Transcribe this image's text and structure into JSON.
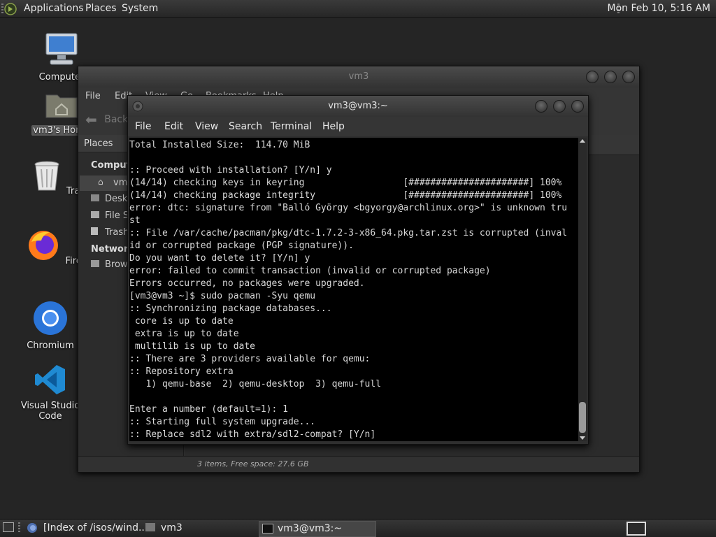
{
  "top_panel": {
    "menus": [
      "Applications",
      "Places",
      "System"
    ],
    "clock": "Mon Feb 10,  5:16 AM"
  },
  "desktop_icons": [
    {
      "label": "Computer",
      "icon": "computer-icon"
    },
    {
      "label": "vm3's Home",
      "icon": "home-folder-icon"
    },
    {
      "label": "Trash",
      "icon": "trash-icon"
    },
    {
      "label": "Firefox",
      "icon": "firefox-icon"
    },
    {
      "label": "Chromium",
      "icon": "chromium-icon"
    },
    {
      "label": "Visual Studio Code",
      "icon": "vscode-icon"
    }
  ],
  "file_manager": {
    "title": "vm3",
    "menus": [
      "File",
      "Edit",
      "View",
      "Go",
      "Bookmarks",
      "Help"
    ],
    "back_label": "Back",
    "sidebar_header": "Places",
    "sidebar": {
      "computer_heading": "Computer",
      "items": [
        "vm3",
        "Desktop",
        "File System",
        "Trash"
      ],
      "network_heading": "Network",
      "network_items": [
        "Browse Network"
      ]
    },
    "status": "3 items, Free space: 27.6 GB"
  },
  "terminal": {
    "title": "vm3@vm3:~",
    "menus": [
      "File",
      "Edit",
      "View",
      "Search",
      "Terminal",
      "Help"
    ],
    "lines": [
      "Total Installed Size:  114.70 MiB",
      "",
      ":: Proceed with installation? [Y/n] y",
      "(14/14) checking keys in keyring                  [######################] 100%",
      "(14/14) checking package integrity                [######################] 100%",
      "error: dtc: signature from \"Balló György <bgyorgy@archlinux.org>\" is unknown tru",
      "st",
      ":: File /var/cache/pacman/pkg/dtc-1.7.2-3-x86_64.pkg.tar.zst is corrupted (inval",
      "id or corrupted package (PGP signature)).",
      "Do you want to delete it? [Y/n] y",
      "error: failed to commit transaction (invalid or corrupted package)",
      "Errors occurred, no packages were upgraded.",
      "[vm3@vm3 ~]$ sudo pacman -Syu qemu",
      ":: Synchronizing package databases...",
      " core is up to date",
      " extra is up to date",
      " multilib is up to date",
      ":: There are 3 providers available for qemu:",
      ":: Repository extra",
      "   1) qemu-base  2) qemu-desktop  3) qemu-full",
      "",
      "Enter a number (default=1): 1",
      ":: Starting full system upgrade...",
      ":: Replace sdl2 with extra/sdl2-compat? [Y/n]"
    ]
  },
  "taskbar": {
    "tasks": [
      {
        "label": "[Index of /isos/wind...",
        "icon": "firefox-icon"
      },
      {
        "label": "vm3",
        "icon": "home-folder-icon"
      },
      {
        "label": "vm3@vm3:~",
        "icon": "terminal-icon"
      }
    ]
  }
}
